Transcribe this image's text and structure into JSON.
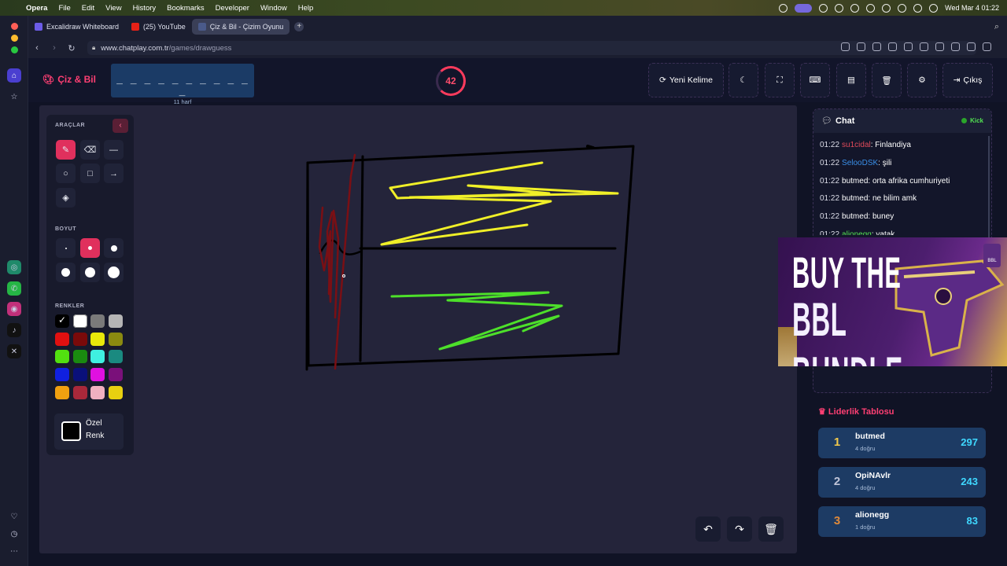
{
  "menubar": {
    "app": "Opera",
    "items": [
      "File",
      "Edit",
      "View",
      "History",
      "Bookmarks",
      "Developer",
      "Window",
      "Help"
    ],
    "clock": "Wed Mar 4  01:22"
  },
  "tabs": [
    {
      "label": "Excalidraw Whiteboard",
      "color": "#6c5ce7"
    },
    {
      "label": "(25) YouTube",
      "color": "#e62117"
    },
    {
      "label": "Çiz & Bil - Çizim Oyunu",
      "color": "#4a5a8a"
    }
  ],
  "address": {
    "host": "www.chatplay.com.tr",
    "path": "/games/drawguess"
  },
  "header": {
    "logo": "Çiz & Bil",
    "word_blanks": "_ _ _ _ _ _ _ _ _ _ _",
    "word_hint": "11 harf",
    "timer": "42",
    "new_word": "Yeni Kelime",
    "exit": "Çıkış"
  },
  "tools": {
    "tools_title": "ARAÇLAR",
    "size_title": "BOYUT",
    "colors_title": "RENKLER",
    "custom_color_line1": "Özel",
    "custom_color_line2": "Renk",
    "palette": [
      "#000000",
      "#ffffff",
      "#7a7a7a",
      "#b5b5b5",
      "#e01010",
      "#7a0a0a",
      "#e8e80a",
      "#8a8a10",
      "#52e010",
      "#1a8a10",
      "#3ff0e0",
      "#1a8a80",
      "#1020e0",
      "#0a107a",
      "#e010e0",
      "#7a107a",
      "#f0a010",
      "#a8283a",
      "#f0b0c0",
      "#e8d010"
    ]
  },
  "chat": {
    "title": "Chat",
    "source": "Kick",
    "messages": [
      {
        "time": "01:22",
        "user": "su1cidal",
        "user_color": "#e04a5a",
        "text": "Finlandiya"
      },
      {
        "time": "01:22",
        "user": "SelooDSK",
        "user_color": "#3a8fe8",
        "text": "şili"
      },
      {
        "time": "01:22",
        "user": "butmed",
        "user_color": "#ffffff",
        "text": "orta afrika cumhuriyeti"
      },
      {
        "time": "01:22",
        "user": "butmed",
        "user_color": "#ffffff",
        "text": "ne bilim amk"
      },
      {
        "time": "01:22",
        "user": "butmed",
        "user_color": "#ffffff",
        "text": "buney"
      },
      {
        "time": "01:22",
        "user": "alionegg",
        "user_color": "#52e052",
        "text": "yatak"
      }
    ]
  },
  "ad": {
    "line1": "BUY THE",
    "line2": "BBL BUNDLE",
    "brand": "BBL"
  },
  "leaderboard": {
    "title": "Liderlik Tablosu",
    "rows": [
      {
        "rank": "1",
        "name": "butmed",
        "sub": "4 doğru",
        "score": "297",
        "rank_color": "#f2c94c"
      },
      {
        "rank": "2",
        "name": "OpiNAvlr",
        "sub": "4 doğru",
        "score": "243",
        "rank_color": "#c0c4d8"
      },
      {
        "rank": "3",
        "name": "alionegg",
        "sub": "1 doğru",
        "score": "83",
        "rank_color": "#e08a3a"
      }
    ]
  }
}
